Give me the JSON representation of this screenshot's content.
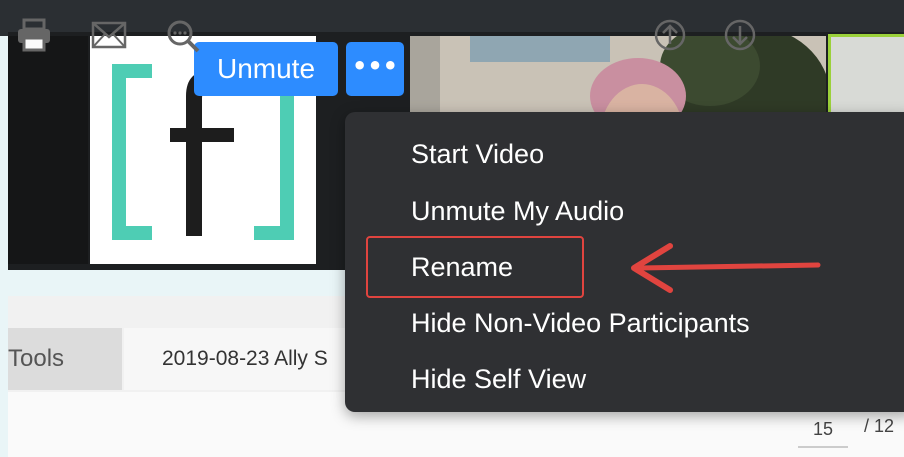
{
  "controls": {
    "unmute_label": "Unmute",
    "more_label": "•••"
  },
  "logo": {
    "glyphs": "[f]",
    "accent_color": "#4ecdb4"
  },
  "menu": {
    "items": [
      {
        "label": "Start Video"
      },
      {
        "label": "Unmute My Audio"
      },
      {
        "label": "Rename"
      },
      {
        "label": "Hide Non-Video Participants"
      },
      {
        "label": "Hide Self View"
      }
    ],
    "highlighted": "Rename"
  },
  "background": {
    "tools_tab": "Tools",
    "document_tab": "2019-08-23 Ally S",
    "page_current": "15",
    "page_total": "/ 12"
  },
  "colors": {
    "zoom_blue": "#2d8cff",
    "menu_bg": "#2f3033",
    "highlight_red": "#e0443f"
  },
  "icons": [
    "printer-icon",
    "mail-icon",
    "zoom-search-icon",
    "arrow-up-circle-icon",
    "arrow-down-circle-icon",
    "options-dots-icon",
    "right-arrow-indicator-icon"
  ]
}
